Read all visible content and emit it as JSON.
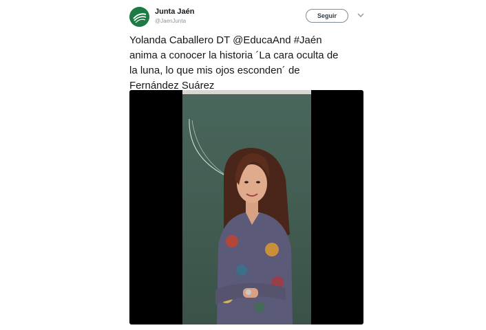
{
  "tweet": {
    "author_name": "Junta Jaén",
    "author_handle": "@JaenJunta",
    "follow_label": "Seguir",
    "text_lines": [
      "Yolanda Caballero DT @EducaAnd #Jaén",
      "anima a conocer la historia ´La cara oculta de",
      "la luna, lo que mis ojos esconden´ de",
      "Fernández Suárez"
    ]
  },
  "icons": {
    "avatar": "junta-logo-icon",
    "caret": "chevron-down-icon",
    "video": "video-thumbnail"
  },
  "colors": {
    "avatar_bg": "#1e7a45",
    "chalkboard": "#3d5a4f",
    "text": "#14171a",
    "muted": "#8a959e"
  }
}
